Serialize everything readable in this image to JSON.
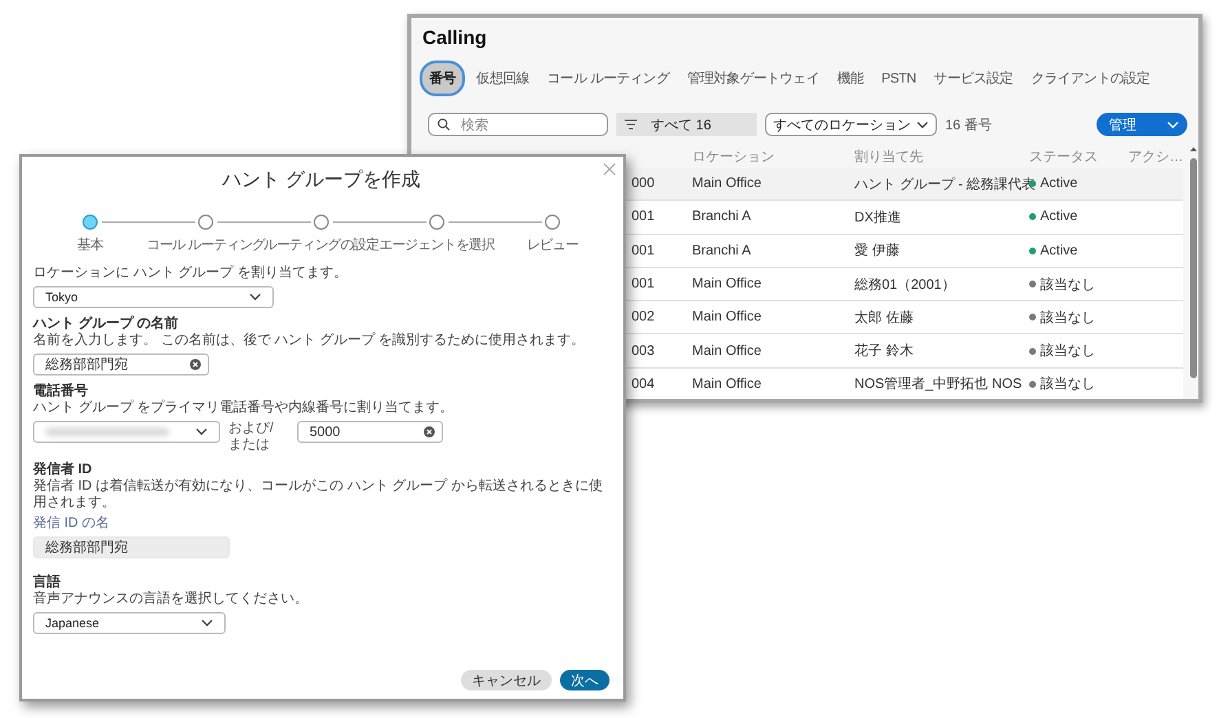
{
  "calling_window": {
    "title": "Calling",
    "tabs": [
      {
        "label": "番号",
        "selected": true
      },
      {
        "label": "仮想回線",
        "selected": false
      },
      {
        "label": "コール ルーティング",
        "selected": false
      },
      {
        "label": "管理対象ゲートウェイ",
        "selected": false
      },
      {
        "label": "機能",
        "selected": false
      },
      {
        "label": "PSTN",
        "selected": false
      },
      {
        "label": "サービス設定",
        "selected": false
      },
      {
        "label": "クライアントの設定",
        "selected": false
      }
    ],
    "search": {
      "placeholder": "検索"
    },
    "filter": "すべて 16",
    "location_filter": "すべてのロケーション",
    "count": "16 番号",
    "manage_button": "管理",
    "table": {
      "columns": [
        "",
        "ロケーション",
        "割り当て先",
        "ステータス",
        "アクシ…"
      ],
      "rows": [
        {
          "column_1": "000",
          "location": "Main Office",
          "assigned_to": "ハント グループ - 総務課代表",
          "status": "Active",
          "color": "#1f9e6e",
          "highlighted": true
        },
        {
          "column_1": "001",
          "location": "Branchi A",
          "assigned_to": "DX推進",
          "status": "Active",
          "color": "#1f9e6e",
          "highlighted": false
        },
        {
          "column_1": "001",
          "location": "Branchi A",
          "assigned_to": "愛 伊藤",
          "status": "Active",
          "color": "#1f9e6e",
          "highlighted": false
        },
        {
          "column_1": "001",
          "location": "Main Office",
          "assigned_to": "総務01（2001）",
          "status": "該当なし",
          "color": "#7a7a7a",
          "highlighted": false
        },
        {
          "column_1": "002",
          "location": "Main Office",
          "assigned_to": "太郎 佐藤",
          "status": "該当なし",
          "color": "#7a7a7a",
          "highlighted": false
        },
        {
          "column_1": "003",
          "location": "Main Office",
          "assigned_to": "花子 鈴木",
          "status": "該当なし",
          "color": "#7a7a7a",
          "highlighted": false
        },
        {
          "column_1": "004",
          "location": "Main Office",
          "assigned_to": "NOS管理者_中野拓也 NOS",
          "status": "該当なし",
          "color": "#7a7a7a",
          "highlighted": false
        }
      ]
    }
  },
  "dialog": {
    "title": "ハント グループを作成",
    "steps": [
      {
        "label": "基本",
        "selected": true
      },
      {
        "label": "コール ルーティング",
        "selected": false
      },
      {
        "label": "ルーティングの設定",
        "selected": false
      },
      {
        "label": "エージェントを選択",
        "selected": false
      },
      {
        "label": "レビュー",
        "selected": false
      }
    ],
    "location": {
      "description": "ロケーションに ハント グループ を割り当てます。",
      "value": "Tokyo"
    },
    "name": {
      "label": "ハント グループ の名前",
      "description": "名前を入力します。 この名前は、後で ハント グループ を識別するために使用されます。",
      "value": "総務部部門宛"
    },
    "phone": {
      "label": "電話番号",
      "description": "ハント グループ をプライマリ電話番号や内線番号に割り当てます。",
      "connector": "および/ または",
      "extension": "5000"
    },
    "caller_id": {
      "label": "発信者 ID",
      "description": "発信者 ID は着信転送が有効になり、コールがこの ハント グループ から転送されるときに使用されます。",
      "sublabel": "発信 ID の名",
      "value": "総務部部門宛"
    },
    "language": {
      "label": "言語",
      "description": "音声アナウンスの言語を選択してください。",
      "value": "Japanese"
    },
    "buttons": [
      {
        "label": "キャンセル",
        "kind": "secondary"
      },
      {
        "label": "次へ",
        "kind": "primary"
      }
    ]
  }
}
